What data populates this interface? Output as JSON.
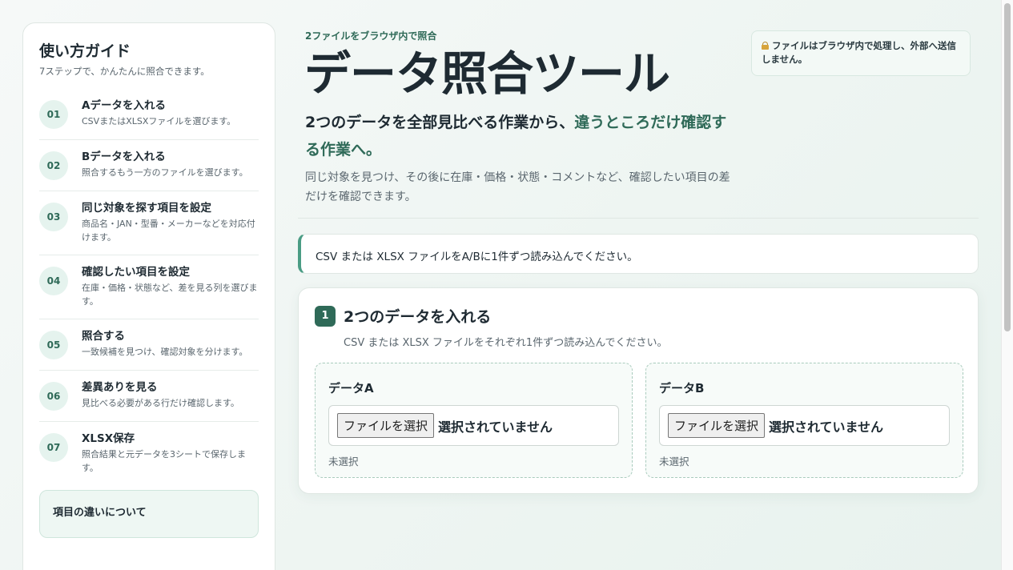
{
  "sidebar": {
    "title": "使い方ガイド",
    "subtitle": "7ステップで、かんたんに照合できます。",
    "steps": [
      {
        "num": "01",
        "title": "Aデータを入れる",
        "desc": "CSVまたはXLSXファイルを選びます。"
      },
      {
        "num": "02",
        "title": "Bデータを入れる",
        "desc": "照合するもう一方のファイルを選びます。"
      },
      {
        "num": "03",
        "title": "同じ対象を探す項目を設定",
        "desc": "商品名・JAN・型番・メーカーなどを対応付けます。"
      },
      {
        "num": "04",
        "title": "確認したい項目を設定",
        "desc": "在庫・価格・状態など、差を見る列を選びます。"
      },
      {
        "num": "05",
        "title": "照合する",
        "desc": "一致候補を見つけ、確認対象を分けます。"
      },
      {
        "num": "06",
        "title": "差異ありを見る",
        "desc": "見比べる必要がある行だけ確認します。"
      },
      {
        "num": "07",
        "title": "XLSX保存",
        "desc": "照合結果と元データを3シートで保存します。"
      }
    ],
    "note_title": "項目の違いについて"
  },
  "header": {
    "eyebrow": "2ファイルをブラウザ内で照合",
    "title": "データ照合ツール",
    "lead_plain": "2つのデータを全部見比べる作業から、",
    "lead_highlight": "違うところだけ確認する作業へ。",
    "description": "同じ対象を見つけ、その後に在庫・価格・状態・コメントなど、確認したい項目の差だけを確認できます。",
    "privacy_note": "ファイルはブラウザ内で処理し、外部へ送信しません。",
    "privacy_icon": "lock-icon"
  },
  "banner": {
    "message": "CSV または XLSX ファイルをA/Bに1件ずつ読み込んでください。"
  },
  "upload_card": {
    "step_badge": "1",
    "title": "2つのデータを入れる",
    "subtitle": "CSV または XLSX ファイルをそれぞれ1件ずつ読み込んでください。",
    "data_a": {
      "label": "データA",
      "button": "ファイルを選択",
      "status": "選択されていません",
      "note": "未選択"
    },
    "data_b": {
      "label": "データB",
      "button": "ファイルを選択",
      "status": "選択されていません",
      "note": "未選択"
    }
  },
  "colors": {
    "accent": "#2f6a58",
    "accent_light": "#e5f3ee",
    "text": "#1e2a32"
  }
}
